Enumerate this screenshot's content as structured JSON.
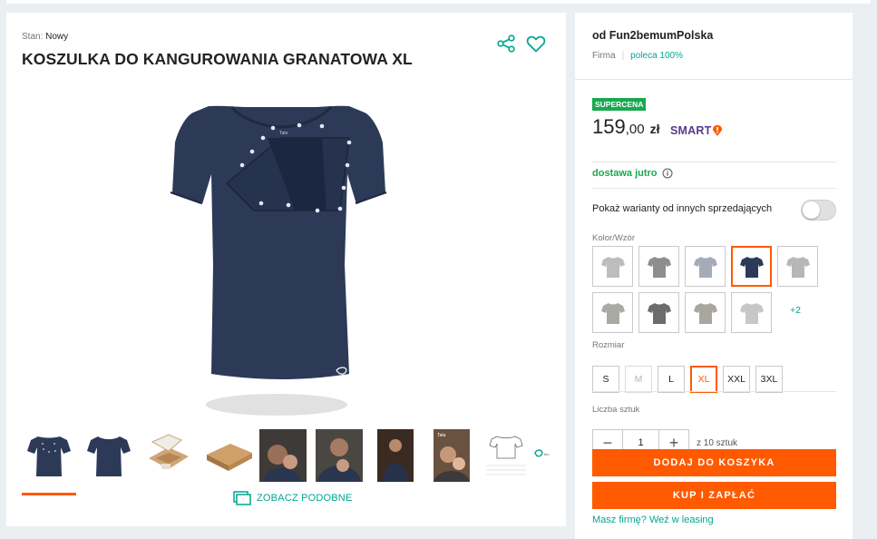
{
  "product": {
    "condition_label": "Stan:",
    "condition_value": "Nowy",
    "title": "KOSZULKA DO KANGUROWANIA GRANATOWA XL",
    "shirt_color": "#2c3a58",
    "thumbnails_count": 10,
    "active_thumbnail": 1,
    "similar_label": "ZOBACZ PODOBNE"
  },
  "seller": {
    "name": "od Fun2bemumPolska",
    "type": "Firma",
    "recommend": "poleca 100%"
  },
  "offer": {
    "badge": "SUPERCENA",
    "price_int": "159",
    "price_dec": ",00",
    "currency": "zł",
    "smart_label": "SMART",
    "delivery": "dostawa jutro",
    "other_sellers_label": "Pokaż warianty od innych sprzedających",
    "other_sellers_toggle": false,
    "color_label": "Kolor/Wzór",
    "colors": [
      {
        "hex": "#bdbdbd"
      },
      {
        "hex": "#8e8e8e"
      },
      {
        "hex": "#a5acb8"
      },
      {
        "hex": "#2c3a58",
        "selected": true
      },
      {
        "hex": "#b7b7b7"
      },
      {
        "hex": "#a9aaa2"
      },
      {
        "hex": "#6c6c6c"
      },
      {
        "hex": "#a8a69e"
      },
      {
        "hex": "#c7c7c7"
      }
    ],
    "more_colors": "+2",
    "size_label": "Rozmiar",
    "sizes": [
      {
        "label": "S"
      },
      {
        "label": "M",
        "disabled": true
      },
      {
        "label": "L"
      },
      {
        "label": "XL",
        "selected": true
      },
      {
        "label": "XXL"
      },
      {
        "label": "3XL"
      }
    ],
    "qty_label": "Liczba sztuk",
    "qty_value": "1",
    "qty_max": "z 10 sztuk",
    "add_to_cart": "DODAJ DO KOSZYKA",
    "buy_now": "KUP I ZAPŁAĆ",
    "leasing": "Masz firmę? Weź w leasing"
  },
  "colors": {
    "accent": "#ff5a00",
    "link": "#00a790",
    "green": "#1aa84f",
    "smart": "#5a3a8c"
  }
}
